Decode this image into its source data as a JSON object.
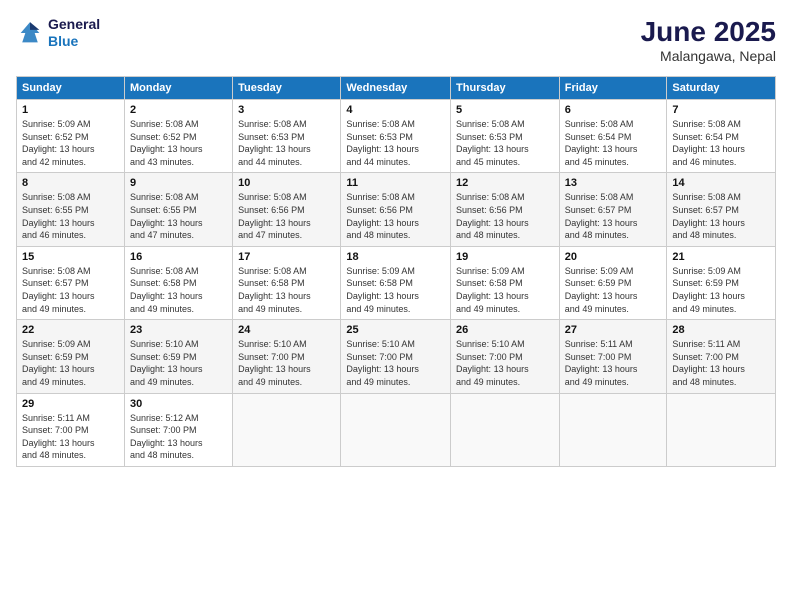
{
  "logo": {
    "line1": "General",
    "line2": "Blue"
  },
  "title": "June 2025",
  "subtitle": "Malangawa, Nepal",
  "days_header": [
    "Sunday",
    "Monday",
    "Tuesday",
    "Wednesday",
    "Thursday",
    "Friday",
    "Saturday"
  ],
  "weeks": [
    [
      {
        "num": "1",
        "sunrise": "5:09 AM",
        "sunset": "6:52 PM",
        "daylight": "13 hours and 42 minutes."
      },
      {
        "num": "2",
        "sunrise": "5:08 AM",
        "sunset": "6:52 PM",
        "daylight": "13 hours and 43 minutes."
      },
      {
        "num": "3",
        "sunrise": "5:08 AM",
        "sunset": "6:53 PM",
        "daylight": "13 hours and 44 minutes."
      },
      {
        "num": "4",
        "sunrise": "5:08 AM",
        "sunset": "6:53 PM",
        "daylight": "13 hours and 44 minutes."
      },
      {
        "num": "5",
        "sunrise": "5:08 AM",
        "sunset": "6:53 PM",
        "daylight": "13 hours and 45 minutes."
      },
      {
        "num": "6",
        "sunrise": "5:08 AM",
        "sunset": "6:54 PM",
        "daylight": "13 hours and 45 minutes."
      },
      {
        "num": "7",
        "sunrise": "5:08 AM",
        "sunset": "6:54 PM",
        "daylight": "13 hours and 46 minutes."
      }
    ],
    [
      {
        "num": "8",
        "sunrise": "5:08 AM",
        "sunset": "6:55 PM",
        "daylight": "13 hours and 46 minutes."
      },
      {
        "num": "9",
        "sunrise": "5:08 AM",
        "sunset": "6:55 PM",
        "daylight": "13 hours and 47 minutes."
      },
      {
        "num": "10",
        "sunrise": "5:08 AM",
        "sunset": "6:56 PM",
        "daylight": "13 hours and 47 minutes."
      },
      {
        "num": "11",
        "sunrise": "5:08 AM",
        "sunset": "6:56 PM",
        "daylight": "13 hours and 48 minutes."
      },
      {
        "num": "12",
        "sunrise": "5:08 AM",
        "sunset": "6:56 PM",
        "daylight": "13 hours and 48 minutes."
      },
      {
        "num": "13",
        "sunrise": "5:08 AM",
        "sunset": "6:57 PM",
        "daylight": "13 hours and 48 minutes."
      },
      {
        "num": "14",
        "sunrise": "5:08 AM",
        "sunset": "6:57 PM",
        "daylight": "13 hours and 48 minutes."
      }
    ],
    [
      {
        "num": "15",
        "sunrise": "5:08 AM",
        "sunset": "6:57 PM",
        "daylight": "13 hours and 49 minutes."
      },
      {
        "num": "16",
        "sunrise": "5:08 AM",
        "sunset": "6:58 PM",
        "daylight": "13 hours and 49 minutes."
      },
      {
        "num": "17",
        "sunrise": "5:08 AM",
        "sunset": "6:58 PM",
        "daylight": "13 hours and 49 minutes."
      },
      {
        "num": "18",
        "sunrise": "5:09 AM",
        "sunset": "6:58 PM",
        "daylight": "13 hours and 49 minutes."
      },
      {
        "num": "19",
        "sunrise": "5:09 AM",
        "sunset": "6:58 PM",
        "daylight": "13 hours and 49 minutes."
      },
      {
        "num": "20",
        "sunrise": "5:09 AM",
        "sunset": "6:59 PM",
        "daylight": "13 hours and 49 minutes."
      },
      {
        "num": "21",
        "sunrise": "5:09 AM",
        "sunset": "6:59 PM",
        "daylight": "13 hours and 49 minutes."
      }
    ],
    [
      {
        "num": "22",
        "sunrise": "5:09 AM",
        "sunset": "6:59 PM",
        "daylight": "13 hours and 49 minutes."
      },
      {
        "num": "23",
        "sunrise": "5:10 AM",
        "sunset": "6:59 PM",
        "daylight": "13 hours and 49 minutes."
      },
      {
        "num": "24",
        "sunrise": "5:10 AM",
        "sunset": "7:00 PM",
        "daylight": "13 hours and 49 minutes."
      },
      {
        "num": "25",
        "sunrise": "5:10 AM",
        "sunset": "7:00 PM",
        "daylight": "13 hours and 49 minutes."
      },
      {
        "num": "26",
        "sunrise": "5:10 AM",
        "sunset": "7:00 PM",
        "daylight": "13 hours and 49 minutes."
      },
      {
        "num": "27",
        "sunrise": "5:11 AM",
        "sunset": "7:00 PM",
        "daylight": "13 hours and 49 minutes."
      },
      {
        "num": "28",
        "sunrise": "5:11 AM",
        "sunset": "7:00 PM",
        "daylight": "13 hours and 48 minutes."
      }
    ],
    [
      {
        "num": "29",
        "sunrise": "5:11 AM",
        "sunset": "7:00 PM",
        "daylight": "13 hours and 48 minutes."
      },
      {
        "num": "30",
        "sunrise": "5:12 AM",
        "sunset": "7:00 PM",
        "daylight": "13 hours and 48 minutes."
      },
      null,
      null,
      null,
      null,
      null
    ]
  ]
}
